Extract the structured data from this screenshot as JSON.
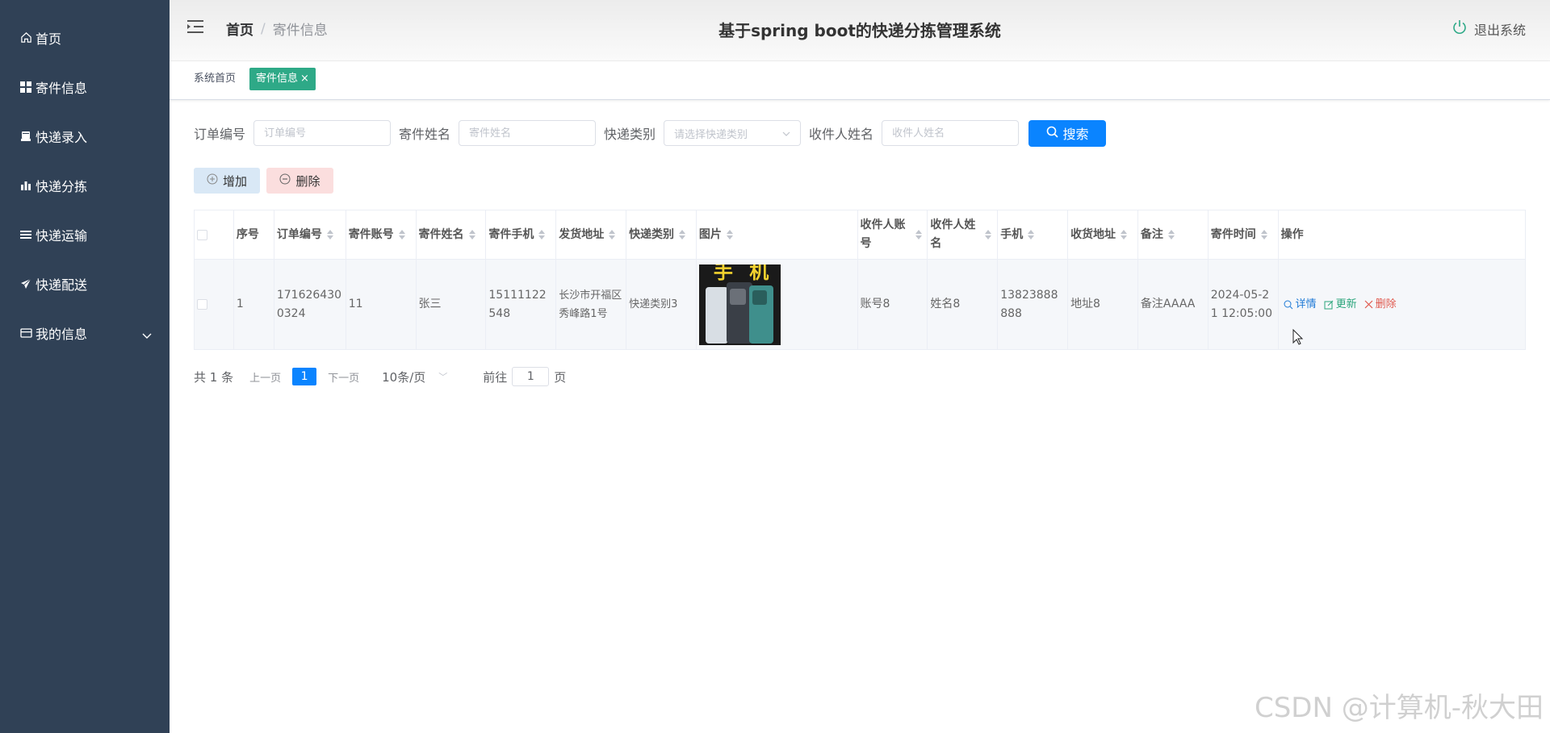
{
  "sidebar": {
    "items": [
      {
        "label": "首页",
        "icon": "home-icon"
      },
      {
        "label": "寄件信息",
        "icon": "grid-icon"
      },
      {
        "label": "快递录入",
        "icon": "printer-icon"
      },
      {
        "label": "快递分拣",
        "icon": "bar-chart-icon"
      },
      {
        "label": "快递运输",
        "icon": "list-icon"
      },
      {
        "label": "快递配送",
        "icon": "send-icon"
      },
      {
        "label": "我的信息",
        "icon": "card-icon"
      }
    ]
  },
  "header": {
    "breadcrumb_home": "首页",
    "breadcrumb_sep": "/",
    "breadcrumb_current": "寄件信息",
    "title": "基于spring boot的快递分拣管理系统",
    "logout_label": "退出系统"
  },
  "tags": {
    "home": "系统首页",
    "active": "寄件信息",
    "close": "×"
  },
  "search": {
    "order_label": "订单编号",
    "order_placeholder": "订单编号",
    "sender_label": "寄件姓名",
    "sender_placeholder": "寄件姓名",
    "type_label": "快递类别",
    "type_placeholder": "请选择快递类别",
    "receiver_label": "收件人姓名",
    "receiver_placeholder": "收件人姓名",
    "search_button": "搜索"
  },
  "actions": {
    "add_label": "增加",
    "delete_label": "删除"
  },
  "table": {
    "headers": [
      "序号",
      "订单编号",
      "寄件账号",
      "寄件姓名",
      "寄件手机",
      "发货地址",
      "快递类别",
      "图片",
      "收件人账号",
      "收件人姓名",
      "手机",
      "收货地址",
      "备注",
      "寄件时间",
      "操作"
    ],
    "row": {
      "index": "1",
      "order_no": "1716264300324",
      "sender_account": "11",
      "sender_name": "张三",
      "sender_phone": "15111122548",
      "ship_address": "长沙市开福区秀峰路1号",
      "express_type": "快递类别3",
      "image_text": "手 机",
      "receiver_account": "账号8",
      "receiver_name": "姓名8",
      "phone": "13823888888",
      "receive_address": "地址8",
      "remark": "备注AAAA",
      "send_time": "2024-05-21 12:05:00"
    },
    "ops": {
      "detail": "详情",
      "update": "更新",
      "delete": "删除"
    }
  },
  "pagination": {
    "total": "共 1 条",
    "prev": "上一页",
    "current_page": "1",
    "next": "下一页",
    "page_size": "10条/页",
    "goto_label": "前往",
    "goto_value": "1",
    "page_suffix": "页"
  },
  "watermark": "CSDN @计算机-秋大田",
  "colors": {
    "sidebar_bg": "#304156",
    "primary": "#0a84ff",
    "tag_active": "#2ea987",
    "op_detail": "#1e7ad6",
    "op_update": "#2aa57b",
    "op_delete": "#e0594e"
  }
}
